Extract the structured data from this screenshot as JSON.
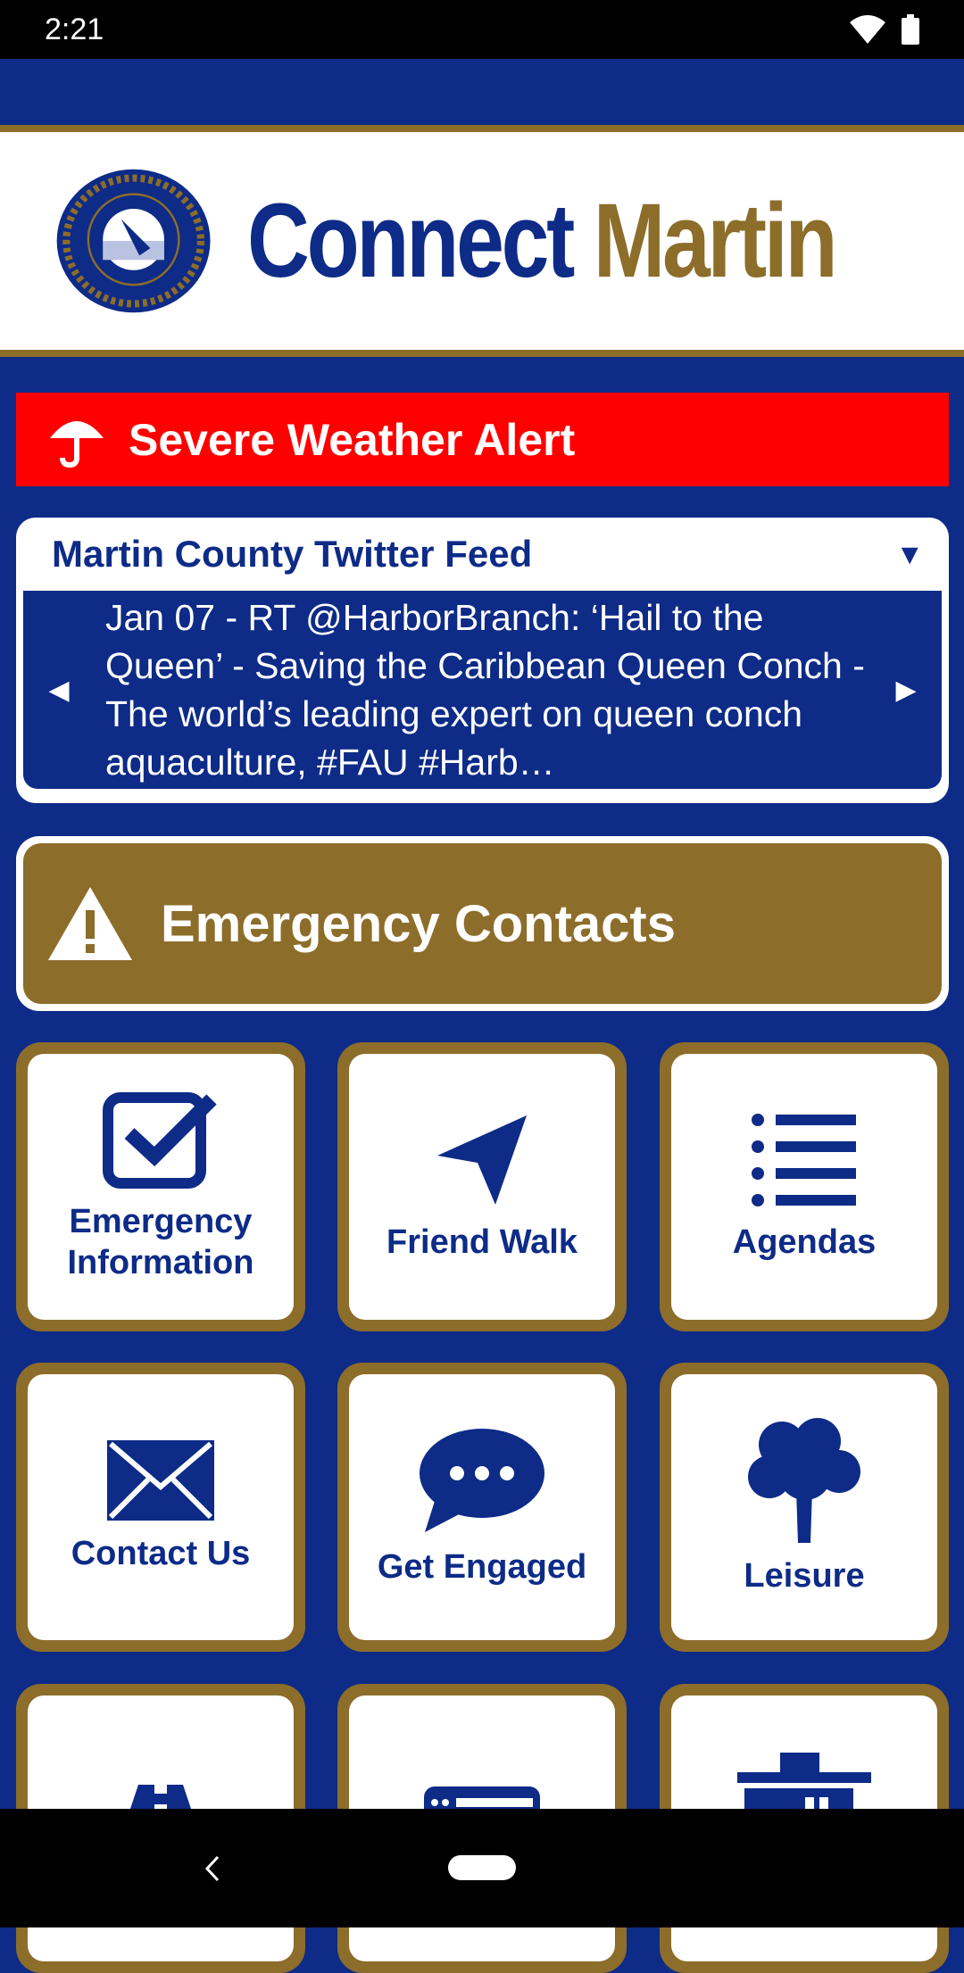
{
  "status": {
    "time": "2:21",
    "icons": [
      "wifi-icon",
      "battery-icon"
    ]
  },
  "header": {
    "title_part1": "Connect",
    "title_part2": "Martin",
    "seal_text": [
      "COUNTY OF MARTIN",
      "STATE OF FLORIDA"
    ]
  },
  "alert": {
    "label": "Severe Weather Alert",
    "icon": "umbrella-icon",
    "color": "#ff0000"
  },
  "twitter": {
    "title": "Martin County Twitter Feed",
    "tweet": "Jan 07 - RT @HarborBranch: ‘Hail to the Queen’ - Saving the Caribbean Queen Conch -The world’s leading expert on queen conch aquaculture, #FAU #Harb…"
  },
  "emergency": {
    "label": "Emergency Contacts",
    "icon": "warning-icon"
  },
  "tiles": [
    {
      "label": "Emergency Information",
      "icon": "checkbox-icon"
    },
    {
      "label": "Friend Walk",
      "icon": "navigation-arrow-icon"
    },
    {
      "label": "Agendas",
      "icon": "list-icon"
    },
    {
      "label": "Contact Us",
      "icon": "envelope-icon"
    },
    {
      "label": "Get Engaged",
      "icon": "chat-bubble-icon"
    },
    {
      "label": "Leisure",
      "icon": "tree-icon"
    },
    {
      "label": "",
      "icon": "road-icon"
    },
    {
      "label": "",
      "icon": "browser-window-icon"
    },
    {
      "label": "",
      "icon": "building-icon"
    }
  ],
  "colors": {
    "primary": "#0d2b87",
    "gold": "#8c6d2a"
  }
}
